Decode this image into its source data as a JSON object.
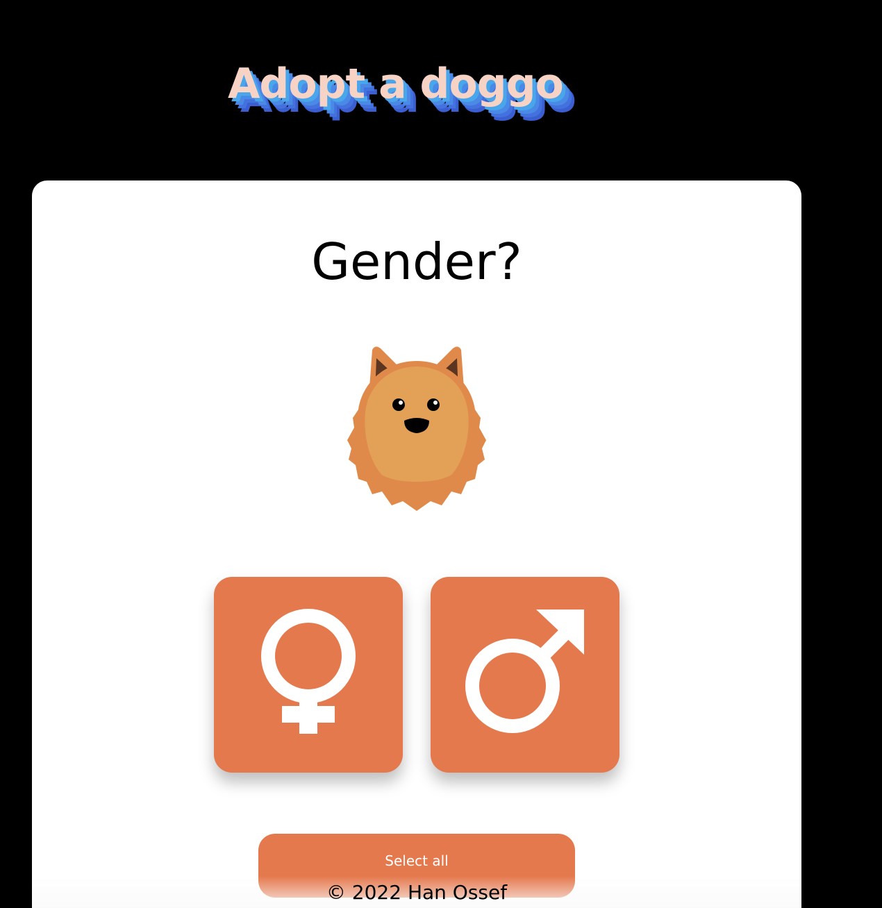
{
  "header": {
    "title": "Adopt a doggo"
  },
  "question": {
    "title": "Gender?"
  },
  "options": [
    {
      "label": "Female",
      "icon": "female-symbol-icon"
    },
    {
      "label": "Male",
      "icon": "male-symbol-icon"
    }
  ],
  "actions": {
    "select_all_label": "Select all"
  },
  "footer": {
    "text": "© 2022 Han Ossef"
  },
  "colors": {
    "background": "#000000",
    "card": "#ffffff",
    "accent": "#e5794e",
    "title_fill": "#f6d3c4",
    "title_shadow_light": "#4aa6ea",
    "title_shadow_dark": "#3b5fd1",
    "dog_fur": "#e3a157",
    "dog_fur_dark": "#df8a4a",
    "dog_ear_inner": "#5c3521"
  }
}
